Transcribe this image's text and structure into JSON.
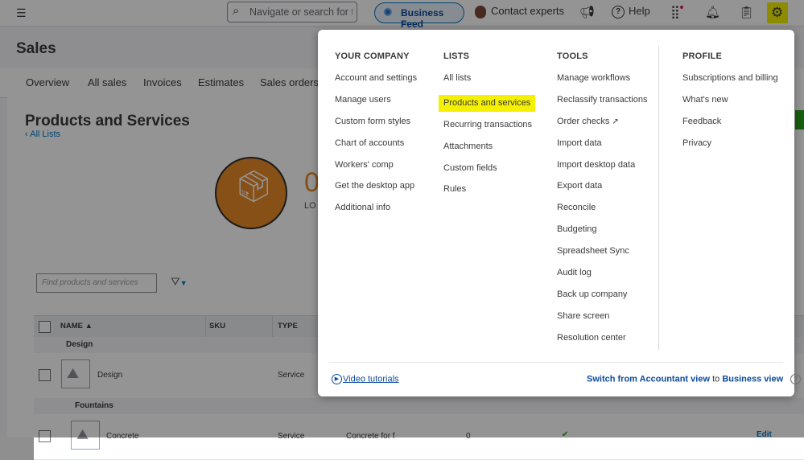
{
  "topbar": {
    "search_placeholder": "Navigate or search for t",
    "business_feed": "Business Feed",
    "contact": "Contact experts",
    "help": "Help"
  },
  "page": {
    "title": "Sales",
    "tabs": [
      "Overview",
      "All sales",
      "Invoices",
      "Estimates",
      "Sales orders"
    ],
    "section_title": "Products and Services",
    "back_link": "All Lists",
    "stat_value": "0",
    "stat_label": "LO",
    "find_placeholder": "Find products and services",
    "table": {
      "headers": {
        "name": "NAME ▲",
        "sku": "SKU",
        "type": "TYPE"
      },
      "groups": [
        "Design",
        "Fountains"
      ],
      "rows": [
        {
          "name": "Design",
          "type": "Service",
          "desc": "",
          "qty": ""
        },
        {
          "name": "Concrete",
          "type": "Service",
          "desc": "Concrete for f",
          "qty": "0"
        }
      ],
      "edit": "Edit"
    }
  },
  "menu": {
    "your_company": {
      "title": "YOUR COMPANY",
      "items": [
        "Account and settings",
        "Manage users",
        "Custom form styles",
        "Chart of accounts",
        "Workers' comp",
        "Get the desktop app",
        "Additional info"
      ]
    },
    "lists": {
      "title": "LISTS",
      "items": [
        "All lists",
        "Products and services",
        "Recurring transactions",
        "Attachments",
        "Custom fields",
        "Rules"
      ]
    },
    "tools": {
      "title": "TOOLS",
      "items": [
        "Manage workflows",
        "Reclassify transactions",
        "Order checks",
        "Import data",
        "Import desktop data",
        "Export data",
        "Reconcile",
        "Budgeting",
        "Spreadsheet Sync",
        "Audit log",
        "Back up company",
        "Share screen",
        "Resolution center"
      ]
    },
    "profile": {
      "title": "PROFILE",
      "items": [
        "Subscriptions and billing",
        "What's new",
        "Feedback",
        "Privacy"
      ]
    },
    "footer": {
      "video": "Video tutorials",
      "switch_a": "Switch from Accountant view",
      "switch_to": "to",
      "switch_b": "Business view"
    }
  },
  "colors": {
    "highlight": "#f5f000",
    "accent": "#0077c5",
    "brand_orange": "#e88a26"
  },
  "icons": [
    "menu-icon",
    "search-icon",
    "business-feed-icon",
    "megaphone-icon",
    "help-icon",
    "apps-grid-icon",
    "bell-icon",
    "clipboard-icon",
    "gear-icon",
    "box-icon",
    "filter-icon",
    "external-link-icon",
    "play-icon",
    "info-icon"
  ]
}
